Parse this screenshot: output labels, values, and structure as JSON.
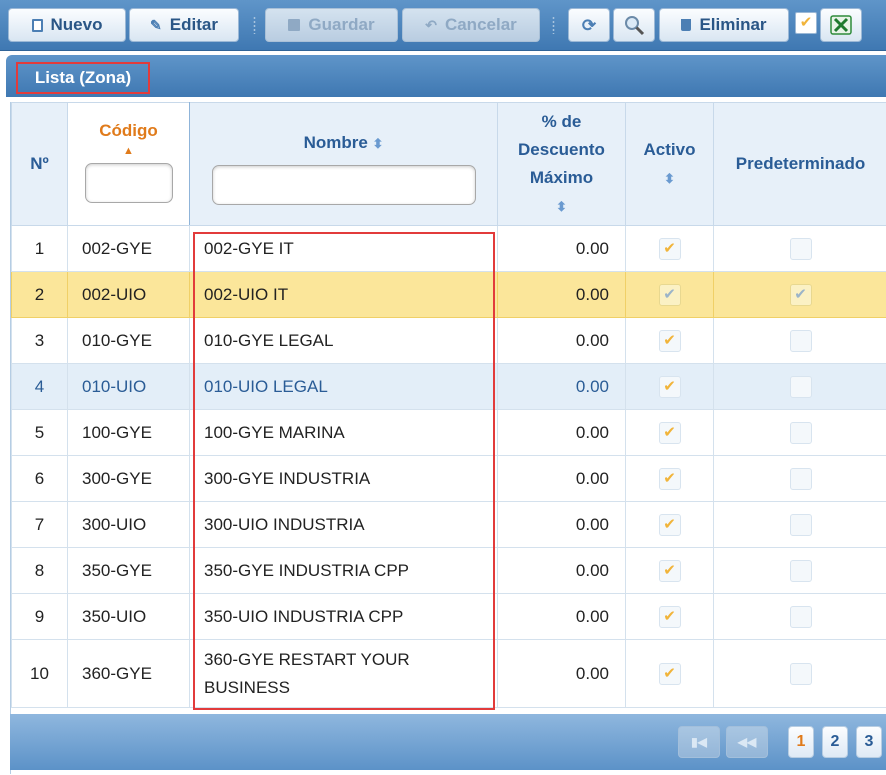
{
  "toolbar": {
    "nuevo": "Nuevo",
    "editar": "Editar",
    "guardar": "Guardar",
    "cancelar": "Cancelar",
    "eliminar": "Eliminar"
  },
  "panel": {
    "title": "Lista (Zona)"
  },
  "columns": {
    "no": "Nº",
    "codigo": "Código",
    "nombre": "Nombre",
    "descuento_1": "% de",
    "descuento_2": "Descuento",
    "descuento_3": "Máximo",
    "activo": "Activo",
    "predeterminado": "Predeterminado"
  },
  "rows": [
    {
      "no": "1",
      "codigo": "002-GYE",
      "nombre": "002-GYE IT",
      "descuento": "0.00",
      "activo": true,
      "predeterminado": false
    },
    {
      "no": "2",
      "codigo": "002-UIO",
      "nombre": "002-UIO IT",
      "descuento": "0.00",
      "activo": true,
      "predeterminado": false
    },
    {
      "no": "3",
      "codigo": "010-GYE",
      "nombre": "010-GYE LEGAL",
      "descuento": "0.00",
      "activo": true,
      "predeterminado": false
    },
    {
      "no": "4",
      "codigo": "010-UIO",
      "nombre": "010-UIO LEGAL",
      "descuento": "0.00",
      "activo": true,
      "predeterminado": false
    },
    {
      "no": "5",
      "codigo": "100-GYE",
      "nombre": "100-GYE MARINA",
      "descuento": "0.00",
      "activo": true,
      "predeterminado": false
    },
    {
      "no": "6",
      "codigo": "300-GYE",
      "nombre": "300-GYE INDUSTRIA",
      "descuento": "0.00",
      "activo": true,
      "predeterminado": false
    },
    {
      "no": "7",
      "codigo": "300-UIO",
      "nombre": "300-UIO INDUSTRIA",
      "descuento": "0.00",
      "activo": true,
      "predeterminado": false
    },
    {
      "no": "8",
      "codigo": "350-GYE",
      "nombre": "350-GYE INDUSTRIA CPP",
      "descuento": "0.00",
      "activo": true,
      "predeterminado": false
    },
    {
      "no": "9",
      "codigo": "350-UIO",
      "nombre": "350-UIO INDUSTRIA CPP",
      "descuento": "0.00",
      "activo": true,
      "predeterminado": false
    },
    {
      "no": "10",
      "codigo": "360-GYE",
      "nombre": "360-GYE RESTART YOUR BUSINESS",
      "descuento": "0.00",
      "activo": true,
      "predeterminado": false
    }
  ],
  "state": {
    "selected_row": 2,
    "hover_row": 4
  },
  "pager": {
    "pages": [
      "1",
      "2",
      "3"
    ],
    "current": "1"
  }
}
